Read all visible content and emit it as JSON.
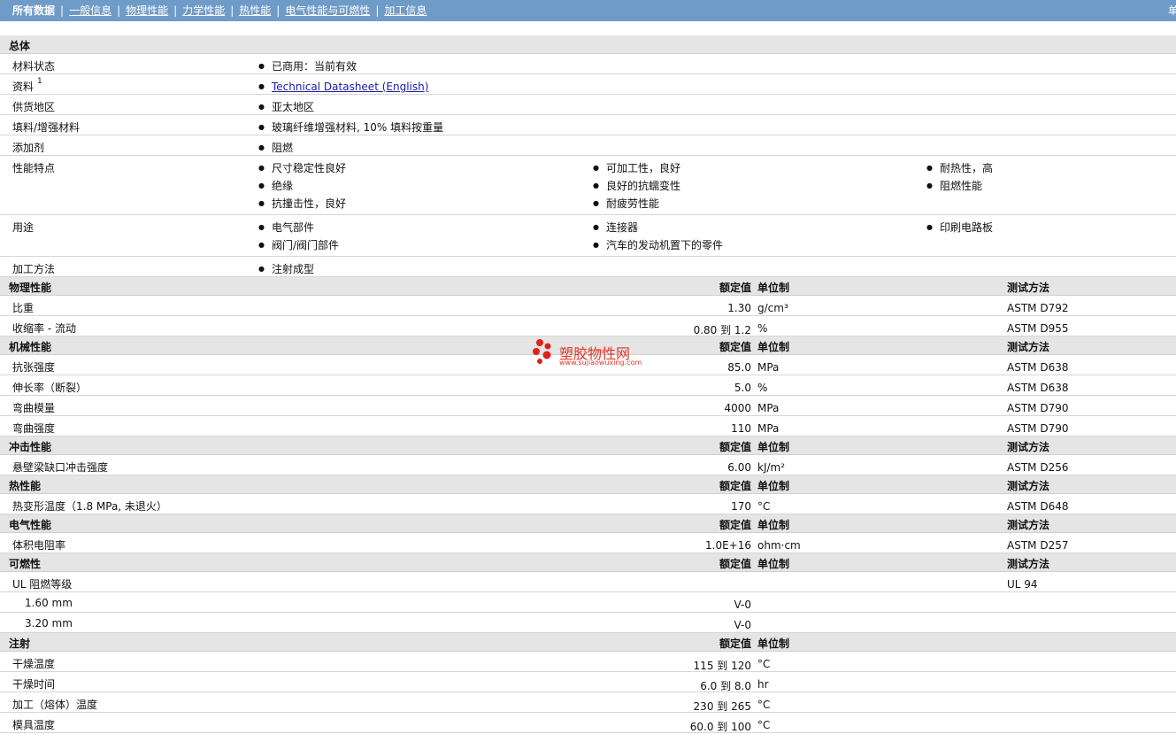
{
  "nav": {
    "active": "所有数据",
    "links": [
      "一般信息",
      "物理性能",
      "力学性能",
      "热性能",
      "电气性能与可燃性",
      "加工信息"
    ],
    "unit_label": "单"
  },
  "watermark": {
    "text": "塑胶物性网",
    "url": "www.sujiaowuxing.com"
  },
  "general": {
    "title": "总体",
    "rows": [
      {
        "label": "材料状态",
        "cols": [
          [
            "已商用：当前有效"
          ]
        ]
      },
      {
        "label": "资料",
        "sup": "1",
        "link": "Technical Datasheet (English)"
      },
      {
        "label": "供货地区",
        "cols": [
          [
            "亚太地区"
          ]
        ]
      },
      {
        "label": "填料/增强材料",
        "cols": [
          [
            "玻璃纤维增强材料, 10% 填料按重量"
          ]
        ]
      },
      {
        "label": "添加剂",
        "cols": [
          [
            "阻燃"
          ]
        ]
      },
      {
        "label": "性能特点",
        "cols": [
          [
            "尺寸稳定性良好",
            "绝缘",
            "抗撞击性，良好"
          ],
          [
            "可加工性，良好",
            "良好的抗蠕变性",
            "耐疲劳性能"
          ],
          [
            "耐热性，高",
            "阻燃性能"
          ]
        ]
      },
      {
        "label": "用途",
        "cols": [
          [
            "电气部件",
            "阀门/阀门部件"
          ],
          [
            "连接器",
            "汽车的发动机置下的零件"
          ],
          [
            "印刷电路板"
          ]
        ]
      },
      {
        "label": "加工方法",
        "cols": [
          [
            "注射成型"
          ]
        ]
      }
    ]
  },
  "headers": {
    "value": "额定值",
    "unit": "单位制",
    "test": "测试方法"
  },
  "sections": [
    {
      "title": "物理性能",
      "show_test": true,
      "rows": [
        {
          "label": "比重",
          "value": "1.30",
          "unit": "g/cm³",
          "test": "ASTM D792"
        },
        {
          "label": "收缩率 - 流动",
          "value": "0.80 到  1.2",
          "unit": "%",
          "test": "ASTM D955"
        }
      ]
    },
    {
      "title": "机械性能",
      "show_test": true,
      "rows": [
        {
          "label": "抗张强度",
          "value": "85.0",
          "unit": "MPa",
          "test": "ASTM D638"
        },
        {
          "label": "伸长率（断裂）",
          "value": "5.0",
          "unit": "%",
          "test": "ASTM D638"
        },
        {
          "label": "弯曲模量",
          "value": "4000",
          "unit": "MPa",
          "test": "ASTM D790"
        },
        {
          "label": "弯曲强度",
          "value": "110",
          "unit": "MPa",
          "test": "ASTM D790"
        }
      ]
    },
    {
      "title": "冲击性能",
      "show_test": true,
      "rows": [
        {
          "label": "悬壁梁缺口冲击强度",
          "value": "6.00",
          "unit": "kJ/m²",
          "test": "ASTM D256"
        }
      ]
    },
    {
      "title": "热性能",
      "show_test": true,
      "rows": [
        {
          "label": "热变形温度（1.8 MPa, 未退火）",
          "value": "170",
          "unit": "°C",
          "test": "ASTM D648"
        }
      ]
    },
    {
      "title": "电气性能",
      "show_test": true,
      "rows": [
        {
          "label": "体积电阻率",
          "value": "1.0E+16",
          "unit": "ohm·cm",
          "test": "ASTM D257"
        }
      ]
    },
    {
      "title": "可燃性",
      "show_test": true,
      "rows": [
        {
          "label": "UL 阻燃等级",
          "value": "",
          "unit": "",
          "test": "UL 94"
        },
        {
          "label": "1.60 mm",
          "sub": true,
          "value": "V-0",
          "unit": "",
          "test": ""
        },
        {
          "label": "3.20 mm",
          "sub": true,
          "value": "V-0",
          "unit": "",
          "test": ""
        }
      ]
    },
    {
      "title": "注射",
      "show_test": false,
      "rows": [
        {
          "label": "干燥温度",
          "value": "115 到  120",
          "unit": "°C",
          "test": ""
        },
        {
          "label": "干燥时间",
          "value": "6.0 到  8.0",
          "unit": "hr",
          "test": ""
        },
        {
          "label": "加工（熔体）温度",
          "value": "230 到  265",
          "unit": "°C",
          "test": ""
        },
        {
          "label": "模具温度",
          "value": "60.0 到  100",
          "unit": "°C",
          "test": ""
        }
      ]
    }
  ]
}
